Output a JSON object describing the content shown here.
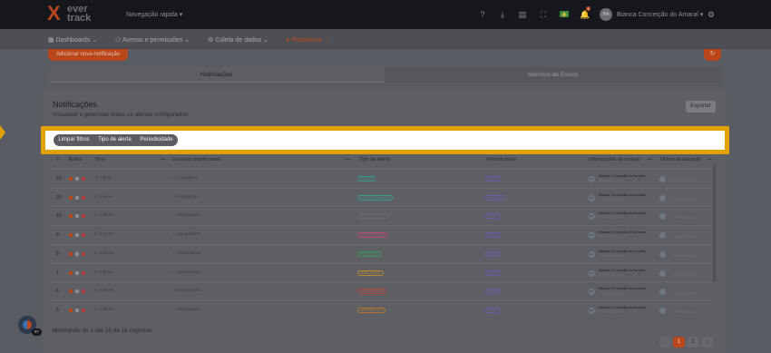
{
  "topbar": {
    "logo_line1": "ever",
    "logo_line2": "track",
    "quick_nav": "Navegação rápida",
    "notification_count": "1",
    "user_initials": "BA",
    "user_name": "Bianca Conceição do Amaral"
  },
  "nav": {
    "items": [
      {
        "label": "Dashboards",
        "icon": "dashboard-icon"
      },
      {
        "label": "Acesso e permissões",
        "icon": "users-icon"
      },
      {
        "label": "Coleta de dados",
        "icon": "gear-icon"
      },
      {
        "label": "Plataforma",
        "icon": "platform-icon"
      }
    ],
    "active_color": "#b9471a"
  },
  "actions": {
    "add_notification": "Adicionar nova notificação"
  },
  "tabs": {
    "notifications": "Notificações",
    "history": "Histórico de Envios"
  },
  "card": {
    "title": "Notificações",
    "subtitle": "Visualizar e gerenciar todos os alertas configurados",
    "export": "Exportar"
  },
  "filters": {
    "clear": "Limpar filtros",
    "alert_type": "Tipo de alerta",
    "periodicity": "Periodicidade",
    "highlight_color": "#e0a200"
  },
  "table": {
    "headers": {
      "id": "#",
      "actions": "Ações",
      "time": "Time",
      "users": "Usuários monitorados",
      "alert_type": "Tipo de alerta",
      "periodicity": "Periodicidade",
      "creation_info": "Informações de criação",
      "last_update": "Última atualização"
    },
    "rows": [
      {
        "id": "21",
        "time": "1 time",
        "users": "2 usuários",
        "type": "OCIOSO",
        "type_color": "#3a9a8a",
        "period": "DIÁRIA",
        "creator": "Bianca Conceição do Amaral",
        "created": "02/10/2025 14:22",
        "updated": "02/10/2025 14:22"
      },
      {
        "id": "20",
        "time": "1 time",
        "users": "3 usuários",
        "type": "RESUMO SEMANAL",
        "type_color": "#3a9a8a",
        "period": "SEMANAL",
        "creator": "Bianca Conceição do Amaral",
        "created": "02/10/2025 14:03",
        "updated": "02/10/2025 14:03"
      },
      {
        "id": "10",
        "time": "4 times",
        "users": "25 usuários",
        "type": "DESCONECTADO",
        "type_color": "#6a6c72",
        "period": "DIÁRIA",
        "creator": "Bianca Conceição do Amaral",
        "created": "17/09/2025 08:51",
        "updated": "17/09/2025 08:51"
      },
      {
        "id": "9",
        "time": "4 times",
        "users": "25 usuários",
        "type": "BLOQUEIO TELA",
        "type_color": "#b84a7a",
        "period": "DIÁRIA",
        "creator": "Bianca Conceição do Amaral",
        "created": "17/09/2025 08:51",
        "updated": "17/09/2025 08:51"
      },
      {
        "id": "8",
        "time": "4 times",
        "users": "25 usuários",
        "type": "PRODUTIVO",
        "type_color": "#3a9a5a",
        "period": "DIÁRIA",
        "creator": "Bianca Conceição do Amaral",
        "created": "17/09/2025 08:51",
        "updated": "17/09/2025 08:51"
      },
      {
        "id": "7",
        "time": "4 times",
        "users": "25 usuários",
        "type": "HORA EXTRA",
        "type_color": "#b88a2a",
        "period": "DIÁRIA",
        "creator": "Bianca Conceição do Amaral",
        "created": "17/09/2025 08:51",
        "updated": "17/09/2025 08:51"
      },
      {
        "id": "6",
        "time": "4 times",
        "users": "25 usuários",
        "type": "RECORRÊNCIA",
        "type_color": "#b8463a",
        "period": "DIÁRIA",
        "creator": "Bianca Conceição do Amaral",
        "created": "17/09/2025 08:51",
        "updated": "17/09/2025 08:51"
      },
      {
        "id": "5",
        "time": "4 times",
        "users": "25 usuários",
        "type": "IMPRODUTIVO",
        "type_color": "#b8762a",
        "period": "DIÁRIA",
        "creator": "Bianca Conceição do Amaral",
        "created": "17/09/2025 08:51",
        "updated": "17/09/2025 08:51"
      }
    ]
  },
  "footer": {
    "summary": "Mostrando de 1 até 10 de 11 registros",
    "prev": "‹",
    "page1": "1",
    "page2": "2",
    "next": "›"
  },
  "fab_badge": "97"
}
